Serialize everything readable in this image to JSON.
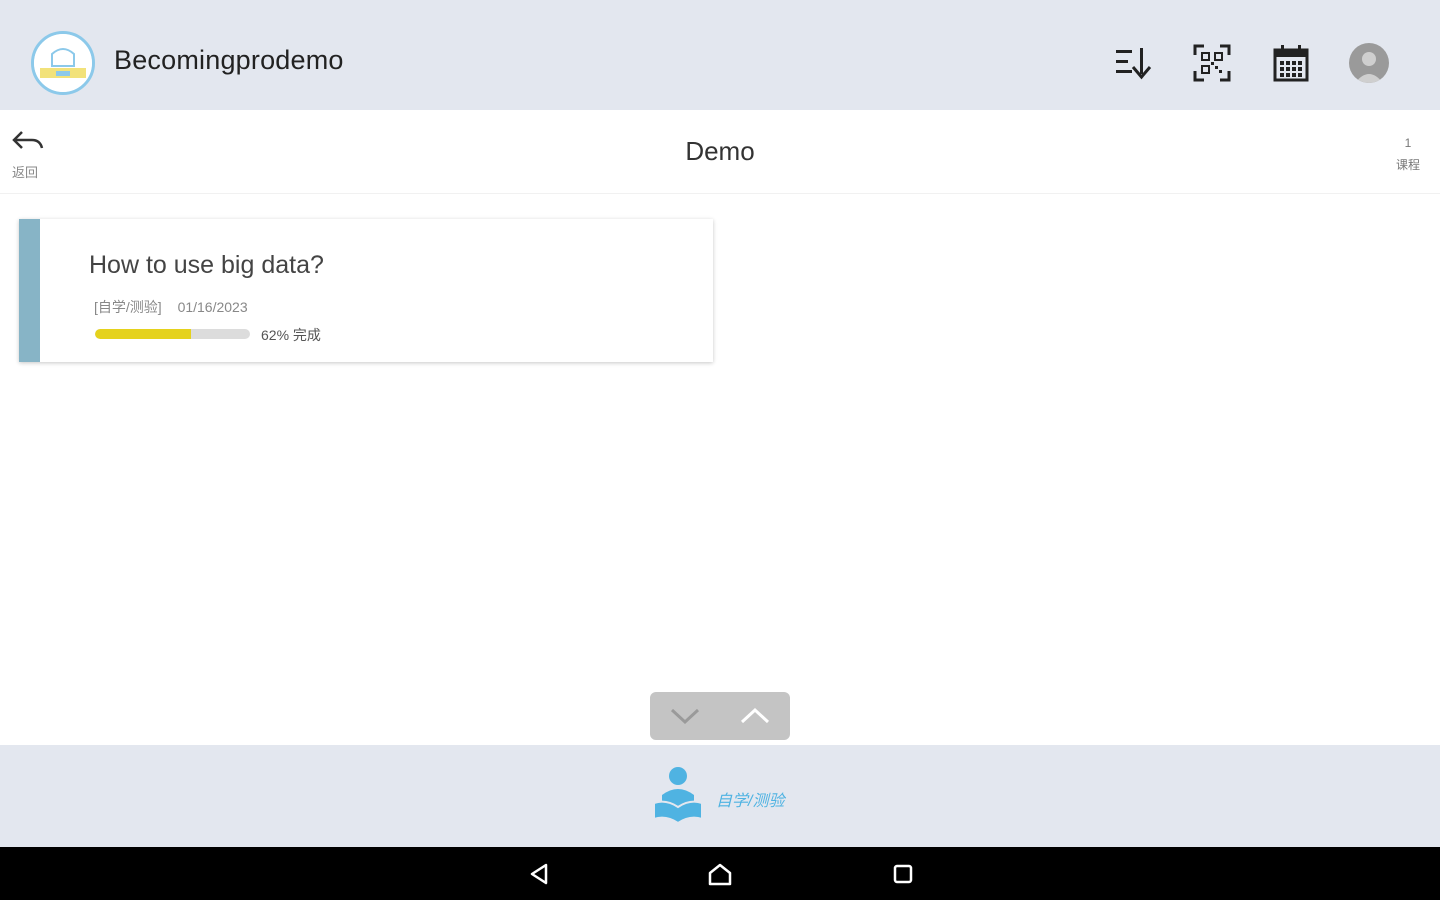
{
  "app": {
    "title": "Becomingprodemo"
  },
  "toolbar": {
    "sort_icon": "sort-descending-icon",
    "scan_icon": "qr-scan-icon",
    "calendar_icon": "calendar-icon",
    "profile_icon": "user-avatar"
  },
  "subheader": {
    "back_label": "返回",
    "title": "Demo",
    "course_count": "1",
    "course_label": "课程"
  },
  "courses": [
    {
      "title": "How to use big data?",
      "type": "[自学/测验]",
      "date": "01/16/2023",
      "progress_percent": 62,
      "progress_text": "62% 完成",
      "accent_color": "#87b4c6",
      "progress_color": "#e5d21c"
    }
  ],
  "tabbar": {
    "active_tab_label": "自学/测验",
    "active_color": "#4fb3e2"
  },
  "colors": {
    "appbar_bg": "#e3e7ef",
    "tab_active": "#4fb3e2"
  }
}
